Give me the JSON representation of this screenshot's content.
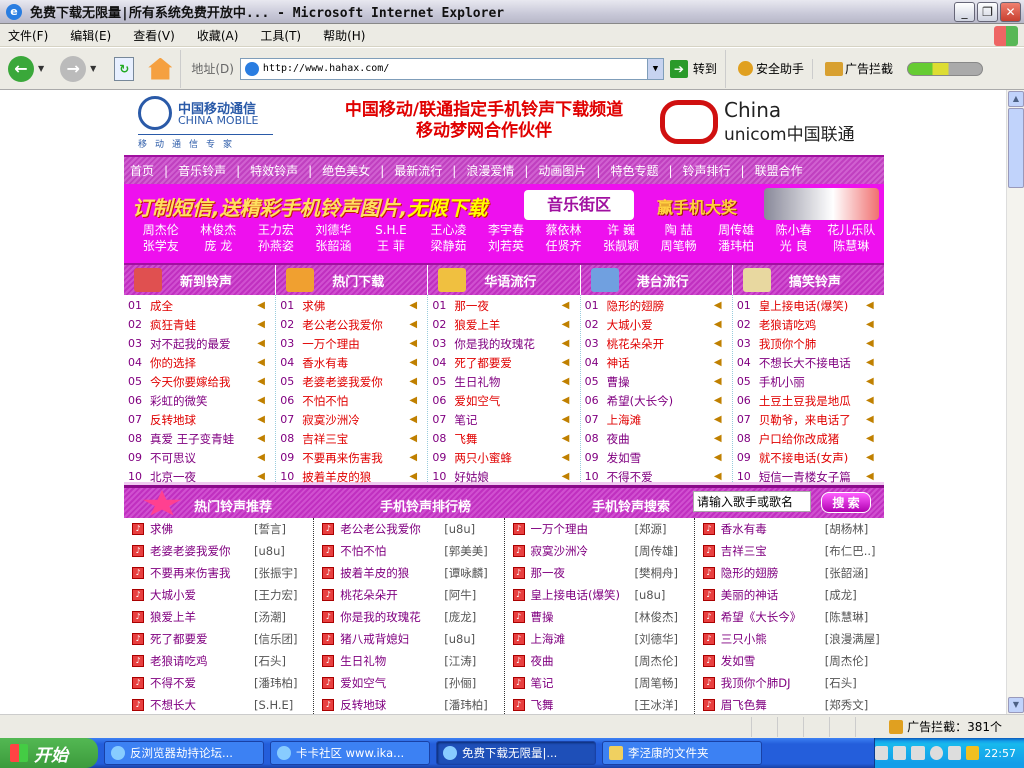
{
  "window": {
    "title": "免费下载无限量|所有系统免费开放中... - Microsoft Internet Explorer"
  },
  "menu": [
    "文件(F)",
    "编辑(E)",
    "查看(V)",
    "收藏(A)",
    "工具(T)",
    "帮助(H)"
  ],
  "toolbar": {
    "address_label": "地址(D)",
    "url": "http://www.hahax.com/",
    "go_label": "转到",
    "security_label": "安全助手",
    "adblock_label": "广告拦截"
  },
  "header": {
    "china_mobile": {
      "cn": "中国移动通信",
      "en": "CHINA MOBILE",
      "sub": "移动通信专家"
    },
    "title_line1": "中国移动/联通指定手机铃声下载频道",
    "title_line2": "移动梦网合作伙伴",
    "china_unicom": {
      "line1": "China",
      "line2": "unicom中国联通"
    }
  },
  "nav": [
    "首页",
    "音乐铃声",
    "特效铃声",
    "绝色美女",
    "最新流行",
    "浪漫爱情",
    "动画图片",
    "特色专题",
    "铃声排行",
    "联盟合作"
  ],
  "banner": {
    "slogan": "订制短信,送精彩手机铃声图片,",
    "slogan_em": "无限下载",
    "music_street": "音乐街区",
    "prize": "赢手机大奖"
  },
  "singers": [
    "周杰伦",
    "林俊杰",
    "王力宏",
    "刘德华",
    "S.H.E",
    "王心凌",
    "李宇春",
    "蔡依林",
    "许 巍",
    "陶 喆",
    "周传雄",
    "陈小春",
    "花儿乐队",
    "张学友",
    "庞 龙",
    "孙燕姿",
    "张韶涵",
    "王 菲",
    "梁静茹",
    "刘若英",
    "任贤齐",
    "张靓颖",
    "周笔畅",
    "潘玮柏",
    "光 良",
    "陈慧琳"
  ],
  "sections": [
    {
      "title": "新到铃声",
      "color": "#e05050",
      "items": [
        {
          "n": "01",
          "t": "成全",
          "c": "r"
        },
        {
          "n": "02",
          "t": "疯狂青蛙",
          "c": "r"
        },
        {
          "n": "03",
          "t": "对不起我的最爱",
          "c": "p"
        },
        {
          "n": "04",
          "t": "你的选择",
          "c": "r"
        },
        {
          "n": "05",
          "t": "今天你要嫁给我",
          "c": "r"
        },
        {
          "n": "06",
          "t": "彩虹的微笑",
          "c": "p"
        },
        {
          "n": "07",
          "t": "反转地球",
          "c": "r"
        },
        {
          "n": "08",
          "t": "真爱 王子变青蛙",
          "c": "p"
        },
        {
          "n": "09",
          "t": "不可思议",
          "c": "p"
        },
        {
          "n": "10",
          "t": "北京一夜",
          "c": "p"
        }
      ]
    },
    {
      "title": "热门下载",
      "color": "#f0a030",
      "items": [
        {
          "n": "01",
          "t": "求佛",
          "c": "r"
        },
        {
          "n": "02",
          "t": "老公老公我爱你",
          "c": "r"
        },
        {
          "n": "03",
          "t": "一万个理由",
          "c": "r"
        },
        {
          "n": "04",
          "t": "香水有毒",
          "c": "r"
        },
        {
          "n": "05",
          "t": "老婆老婆我爱你",
          "c": "r"
        },
        {
          "n": "06",
          "t": "不怕不怕",
          "c": "r"
        },
        {
          "n": "07",
          "t": "寂寞沙洲冷",
          "c": "r"
        },
        {
          "n": "08",
          "t": "吉祥三宝",
          "c": "r"
        },
        {
          "n": "09",
          "t": "不要再来伤害我",
          "c": "r"
        },
        {
          "n": "10",
          "t": "披着羊皮的狼",
          "c": "r"
        }
      ]
    },
    {
      "title": "华语流行",
      "color": "#f0c040",
      "items": [
        {
          "n": "01",
          "t": "那一夜",
          "c": "r"
        },
        {
          "n": "02",
          "t": "狼爱上羊",
          "c": "r"
        },
        {
          "n": "03",
          "t": "你是我的玫瑰花",
          "c": "p"
        },
        {
          "n": "04",
          "t": "死了都要爱",
          "c": "r"
        },
        {
          "n": "05",
          "t": "生日礼物",
          "c": "p"
        },
        {
          "n": "06",
          "t": "爱如空气",
          "c": "r"
        },
        {
          "n": "07",
          "t": "笔记",
          "c": "p"
        },
        {
          "n": "08",
          "t": "飞舞",
          "c": "r"
        },
        {
          "n": "09",
          "t": "两只小蜜蜂",
          "c": "r"
        },
        {
          "n": "10",
          "t": "好姑娘",
          "c": "p"
        }
      ]
    },
    {
      "title": "港台流行",
      "color": "#70a0e0",
      "items": [
        {
          "n": "01",
          "t": "隐形的翅膀",
          "c": "r"
        },
        {
          "n": "02",
          "t": "大城小爱",
          "c": "r"
        },
        {
          "n": "03",
          "t": "桃花朵朵开",
          "c": "r"
        },
        {
          "n": "04",
          "t": "神话",
          "c": "r"
        },
        {
          "n": "05",
          "t": "曹操",
          "c": "p"
        },
        {
          "n": "06",
          "t": "希望(大长今)",
          "c": "p"
        },
        {
          "n": "07",
          "t": "上海滩",
          "c": "r"
        },
        {
          "n": "08",
          "t": "夜曲",
          "c": "p"
        },
        {
          "n": "09",
          "t": "发如雪",
          "c": "p"
        },
        {
          "n": "10",
          "t": "不得不爱",
          "c": "p"
        }
      ]
    },
    {
      "title": "搞笑铃声",
      "color": "#e8d8a0",
      "items": [
        {
          "n": "01",
          "t": "皇上接电话(爆笑)",
          "c": "r"
        },
        {
          "n": "02",
          "t": "老狼请吃鸡",
          "c": "r"
        },
        {
          "n": "03",
          "t": "我顶你个肺",
          "c": "r"
        },
        {
          "n": "04",
          "t": "不想长大不接电话",
          "c": "p"
        },
        {
          "n": "05",
          "t": "手机小丽",
          "c": "p"
        },
        {
          "n": "06",
          "t": "土豆土豆我是地瓜",
          "c": "r"
        },
        {
          "n": "07",
          "t": "贝勒爷，来电话了",
          "c": "r"
        },
        {
          "n": "08",
          "t": "户口给你改成猪",
          "c": "r"
        },
        {
          "n": "09",
          "t": "就不接电话(女声)",
          "c": "r"
        },
        {
          "n": "10",
          "t": "短信一青楼女子篇",
          "c": "p"
        }
      ]
    }
  ],
  "bottom": {
    "hot_title": "热门铃声推荐",
    "rank_title": "手机铃声排行榜",
    "search_title": "手机铃声搜索",
    "search_value": "请输入歌手或歌名",
    "search_button": "搜 索",
    "columns": [
      [
        {
          "t": "求佛",
          "a": "[誓言]"
        },
        {
          "t": "老婆老婆我爱你",
          "a": "[u8u]"
        },
        {
          "t": "不要再来伤害我",
          "a": "[张振宇]"
        },
        {
          "t": "大城小爱",
          "a": "[王力宏]"
        },
        {
          "t": "狼爱上羊",
          "a": "[汤潮]"
        },
        {
          "t": "死了都要爱",
          "a": "[信乐团]"
        },
        {
          "t": "老狼请吃鸡",
          "a": "[石头]"
        },
        {
          "t": "不得不爱",
          "a": "[潘玮柏]"
        },
        {
          "t": "不想长大",
          "a": "[S.H.E]"
        }
      ],
      [
        {
          "t": "老公老公我爱你",
          "a": "[u8u]"
        },
        {
          "t": "不怕不怕",
          "a": "[郭美美]"
        },
        {
          "t": "披着羊皮的狼",
          "a": "[谭咏麟]"
        },
        {
          "t": "桃花朵朵开",
          "a": "[阿牛]"
        },
        {
          "t": "你是我的玫瑰花",
          "a": "[庞龙]"
        },
        {
          "t": "猪八戒背媳妇",
          "a": "[u8u]"
        },
        {
          "t": "生日礼物",
          "a": "[江涛]"
        },
        {
          "t": "爱如空气",
          "a": "[孙俪]"
        },
        {
          "t": "反转地球",
          "a": "[潘玮柏]"
        }
      ],
      [
        {
          "t": "一万个理由",
          "a": "[郑源]"
        },
        {
          "t": "寂寞沙洲冷",
          "a": "[周传雄]"
        },
        {
          "t": "那一夜",
          "a": "[樊桐舟]"
        },
        {
          "t": "皇上接电话(爆笑)",
          "a": "[u8u]"
        },
        {
          "t": "曹操",
          "a": "[林俊杰]"
        },
        {
          "t": "上海滩",
          "a": "[刘德华]"
        },
        {
          "t": "夜曲",
          "a": "[周杰伦]"
        },
        {
          "t": "笔记",
          "a": "[周笔畅]"
        },
        {
          "t": "飞舞",
          "a": "[王冰洋]"
        }
      ],
      [
        {
          "t": "香水有毒",
          "a": "[胡杨林]"
        },
        {
          "t": "吉祥三宝",
          "a": "[布仁巴..]"
        },
        {
          "t": "隐形的翅膀",
          "a": "[张韶涵]"
        },
        {
          "t": "美丽的神话",
          "a": "[成龙]"
        },
        {
          "t": "希望《大长今》",
          "a": "[陈慧琳]"
        },
        {
          "t": "三只小熊",
          "a": "[浪漫满屋]"
        },
        {
          "t": "发如雪",
          "a": "[周杰伦]"
        },
        {
          "t": "我顶你个肺DJ",
          "a": "[石头]"
        },
        {
          "t": "眉飞色舞",
          "a": "[郑秀文]"
        }
      ]
    ]
  },
  "statusbar": {
    "adblock": "广告拦截：381个"
  },
  "taskbar": {
    "start": "开始",
    "tasks": [
      {
        "label": "反浏览器劫持论坛...",
        "icon": "ie"
      },
      {
        "label": "卡卡社区 www.ika...",
        "icon": "ie"
      },
      {
        "label": "免费下载无限量|...",
        "icon": "ie",
        "active": true
      },
      {
        "label": "李泾康的文件夹",
        "icon": "folder"
      }
    ],
    "clock": "22:57"
  },
  "colors": {
    "red": "#e00000",
    "purple": "#800080",
    "magenta": "#ee10ee"
  }
}
